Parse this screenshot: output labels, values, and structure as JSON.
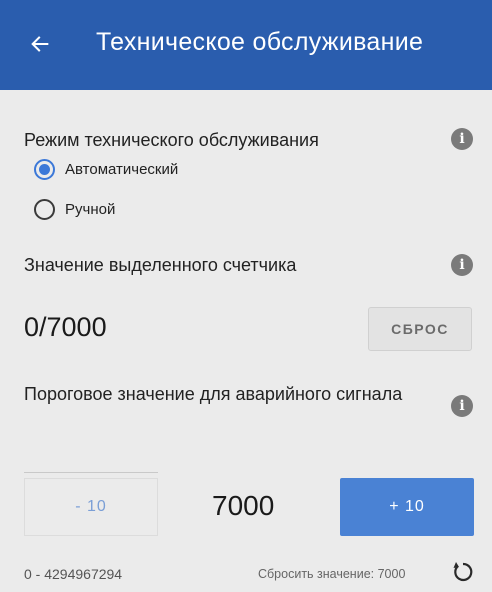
{
  "appbar": {
    "title": "Техническое обслуживание",
    "back_icon": "arrow-left-icon"
  },
  "mode": {
    "title": "Режим технического обслуживания",
    "options": [
      {
        "label": "Автоматический",
        "checked": true
      },
      {
        "label": "Ручной",
        "checked": false
      }
    ]
  },
  "counter": {
    "title": "Значение выделенного счетчика",
    "value": "0/7000",
    "reset_label": "СБРОС"
  },
  "threshold": {
    "title": "Пороговое значение для аварийного сигнала",
    "minus_label": "- 10",
    "value": "7000",
    "plus_label": "+ 10",
    "range": "0 - 4294967294",
    "reset_value_label": "Сбросить значение: 7000"
  },
  "colors": {
    "appbar": "#2a5dae",
    "accent": "#3b78d8",
    "plus_button": "#4a82d4",
    "background": "#ebebeb"
  }
}
